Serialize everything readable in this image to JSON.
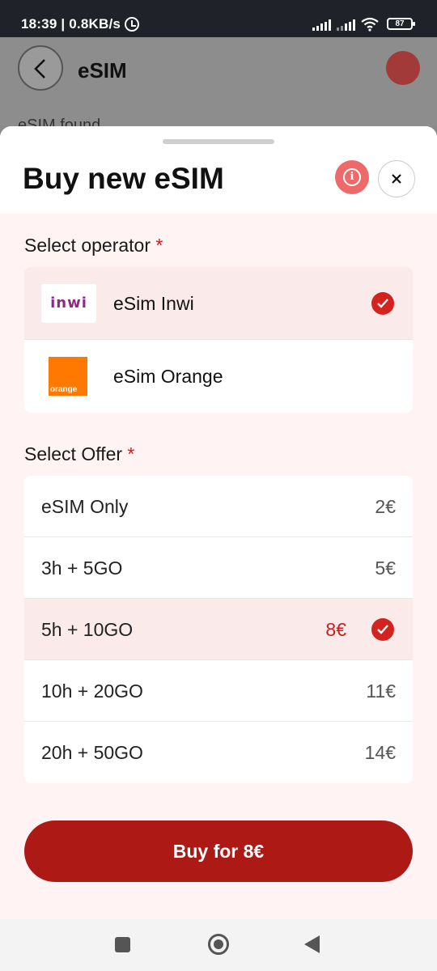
{
  "status_bar": {
    "time_speed": "18:39 | 0.8KB/s",
    "battery": "87"
  },
  "background_screen": {
    "title": "eSIM",
    "partial_text": "eSIM found"
  },
  "sheet": {
    "title": "Buy new eSIM",
    "operator_section": {
      "label": "Select operator",
      "required_mark": "*",
      "operators": [
        {
          "name": "eSim Inwi",
          "logo_text": "inwi",
          "selected": true
        },
        {
          "name": "eSim Orange",
          "logo_text": "orange",
          "selected": false
        }
      ]
    },
    "offer_section": {
      "label": "Select Offer",
      "required_mark": "*",
      "offers": [
        {
          "name": "eSIM Only",
          "price": "2€",
          "selected": false
        },
        {
          "name": "3h + 5GO",
          "price": "5€",
          "selected": false
        },
        {
          "name": "5h + 10GO",
          "price": "8€",
          "selected": true
        },
        {
          "name": "10h + 20GO",
          "price": "11€",
          "selected": false
        },
        {
          "name": "20h + 50GO",
          "price": "14€",
          "selected": false
        }
      ]
    },
    "buy_button_label": "Buy for 8€"
  },
  "colors": {
    "accent": "#ad1a16",
    "check": "#d4221e",
    "selected_bg": "#fbeaea",
    "orange_brand": "#ff7900",
    "inwi_brand": "#8c2a88"
  }
}
